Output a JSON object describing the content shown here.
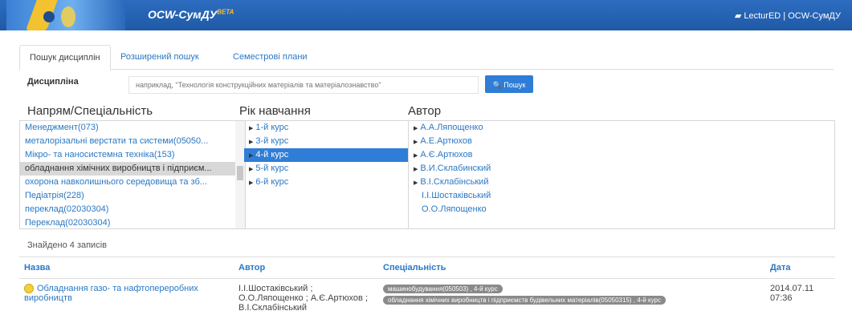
{
  "header": {
    "brand": "OCW-СумДУ",
    "brand_sup": "BETA",
    "right_text": "LecturED | OCW-СумДУ"
  },
  "tabs": [
    {
      "label": "Пошук дисциплін"
    },
    {
      "label": "Розширений пошук"
    },
    {
      "label": "Семестрові плани"
    }
  ],
  "search": {
    "label": "Дисципліна",
    "placeholder": "наприклад, \"Технологія конструкційних матеріалів та матеріалознавство\"",
    "button": "Пошук"
  },
  "columns": {
    "specialty": "Напрям/Спеціальність",
    "year": "Рік навчання",
    "author": "Автор"
  },
  "specialties": [
    "Менеджмент(073)",
    "металорізальні верстати та системи(05050...",
    "Мікро- та наносистемна техніка(153)",
    "обладнання хімічних виробництв і підприєм...",
    "охорона навколишнього середовища та зб...",
    "Педіатрія(228)",
    "переклад(02030304)",
    "Переклад(02030304)"
  ],
  "years": [
    "1-й курс",
    "3-й курс",
    "4-й курс",
    "5-й курс",
    "6-й курс"
  ],
  "authors": [
    "А.А.Ляпощенко",
    "А.Е.Артюхов",
    "А.Є.Артюхов",
    "В.И.Склабинский",
    "В.І.Склабінський",
    "І.І.Шостаківський",
    "О.О.Ляпощенко"
  ],
  "results": {
    "found": "Знайдено 4 записів",
    "headers": {
      "name": "Назва",
      "author": "Автор",
      "spec": "Спеціальність",
      "date": "Дата"
    },
    "rows": [
      {
        "name": "Обладнання газо- та нафтопереробних виробництв",
        "author": "І.І.Шостаківський ; О.О.Ляпощенко ; А.Є.Артюхов ; В.І.Склабінський",
        "badges": [
          "машинобудування(050503) , 4-й курс",
          "обладнання хімічних виробництв і підприємств будівельних матеріалів(05050315) , 4-й курс"
        ],
        "date": "2014.07.11 07:36"
      }
    ]
  },
  "colors": {
    "topbar": "#1f5aa6",
    "link": "#2a78c4",
    "highlight": "#2f7dd6"
  },
  "icons": {
    "search": "search-icon",
    "document": "document-icon"
  }
}
